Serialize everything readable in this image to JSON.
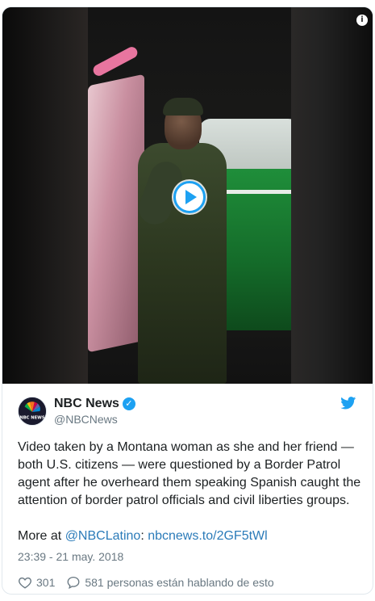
{
  "tweet": {
    "author_name": "NBC News",
    "author_handle": "@NBCNews",
    "avatar_label": "NBC NEWS",
    "verified_glyph": "✓",
    "text_main": "Video taken by a Montana woman as she and her friend — both U.S. citizens — were questioned by a Border Patrol agent after he overheard them speaking Spanish caught the attention of border patrol officials and civil liberties groups.",
    "more_at": "More at ",
    "mention": "@NBCLatino",
    "separator": ": ",
    "url": "nbcnews.to/2GF5tWl",
    "timestamp": "23:39 - 21 may. 2018",
    "likes": "301",
    "replies_text": "581 personas están hablando de esto"
  },
  "media": {
    "info_glyph": "i",
    "icons": [
      "play-icon",
      "info-icon"
    ]
  },
  "colors": {
    "accent": "#1da1f2",
    "link": "#2b7bb9",
    "muted": "#697882",
    "text": "#1c2022"
  },
  "icons": [
    "twitter-bird-icon",
    "verified-icon",
    "heart-icon",
    "reply-icon",
    "nbc-peacock-icon"
  ]
}
